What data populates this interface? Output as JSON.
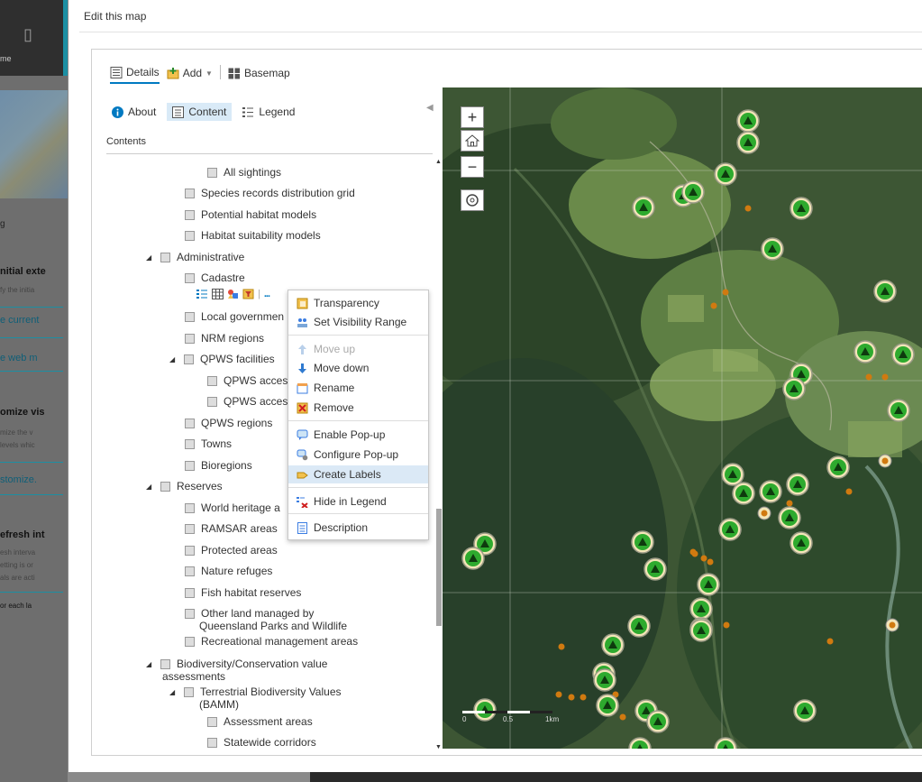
{
  "background": {
    "nav_label": "me",
    "texts": [
      "g",
      "nitial exte",
      "fy the initia",
      "e current",
      "e web m",
      "omize vis",
      "mize the v",
      "levels whic",
      "stomize.",
      "efresh int",
      "esh interva",
      "etting is or",
      "als are acti",
      "or each la"
    ]
  },
  "modal": {
    "title": "Edit this map"
  },
  "toolbar": {
    "details": "Details",
    "add": "Add",
    "basemap": "Basemap"
  },
  "panel": {
    "tabs": {
      "about": "About",
      "content": "Content",
      "legend": "Legend"
    },
    "contents_label": "Contents",
    "tree": [
      {
        "label": "All sightings"
      },
      {
        "label": "Species records distribution grid"
      },
      {
        "label": "Potential habitat models"
      },
      {
        "label": "Habitat suitability models"
      },
      {
        "label": "Administrative"
      },
      {
        "label": "Cadastre"
      },
      {
        "label": "Local governmen"
      },
      {
        "label": "NRM regions"
      },
      {
        "label": "QPWS facilities"
      },
      {
        "label": "QPWS acces"
      },
      {
        "label": "QPWS acces"
      },
      {
        "label": "QPWS regions"
      },
      {
        "label": "Towns"
      },
      {
        "label": "Bioregions"
      },
      {
        "label": "Reserves"
      },
      {
        "label": "World heritage a"
      },
      {
        "label": "RAMSAR areas"
      },
      {
        "label": "Protected areas"
      },
      {
        "label": "Nature refuges"
      },
      {
        "label": "Fish habitat reserves"
      },
      {
        "label": "Other land managed by"
      },
      {
        "label": "Queensland Parks and Wildlife"
      },
      {
        "label": "Recreational management areas"
      },
      {
        "label": "Biodiversity/Conservation value"
      },
      {
        "label": "assessments"
      },
      {
        "label": "Terrestrial Biodiversity Values"
      },
      {
        "label": "(BAMM)"
      },
      {
        "label": "Assessment areas"
      },
      {
        "label": "Statewide corridors"
      }
    ],
    "layer_tools_more": "..."
  },
  "context_menu": [
    {
      "label": "Transparency",
      "icon": "transparency-icon"
    },
    {
      "label": "Set Visibility Range",
      "icon": "visibility-range-icon"
    },
    {
      "label": "Move up",
      "icon": "arrow-up-icon",
      "disabled": true
    },
    {
      "label": "Move down",
      "icon": "arrow-down-icon"
    },
    {
      "label": "Rename",
      "icon": "rename-icon"
    },
    {
      "label": "Remove",
      "icon": "remove-icon"
    },
    {
      "label": "Enable Pop-up",
      "icon": "popup-icon"
    },
    {
      "label": "Configure Pop-up",
      "icon": "configure-popup-icon"
    },
    {
      "label": "Create Labels",
      "icon": "labels-icon",
      "highlighted": true
    },
    {
      "label": "Hide in Legend",
      "icon": "hide-legend-icon"
    },
    {
      "label": "Description",
      "icon": "description-icon"
    }
  ],
  "map": {
    "zoom_in": "+",
    "zoom_out": "−",
    "scale_labels": [
      "0",
      "0.5",
      "1km"
    ]
  },
  "colors": {
    "accent": "#0079c1",
    "marker_green": "#2eaa2e",
    "marker_ring": "#f3e6b8",
    "dot_orange": "#d07a10"
  }
}
